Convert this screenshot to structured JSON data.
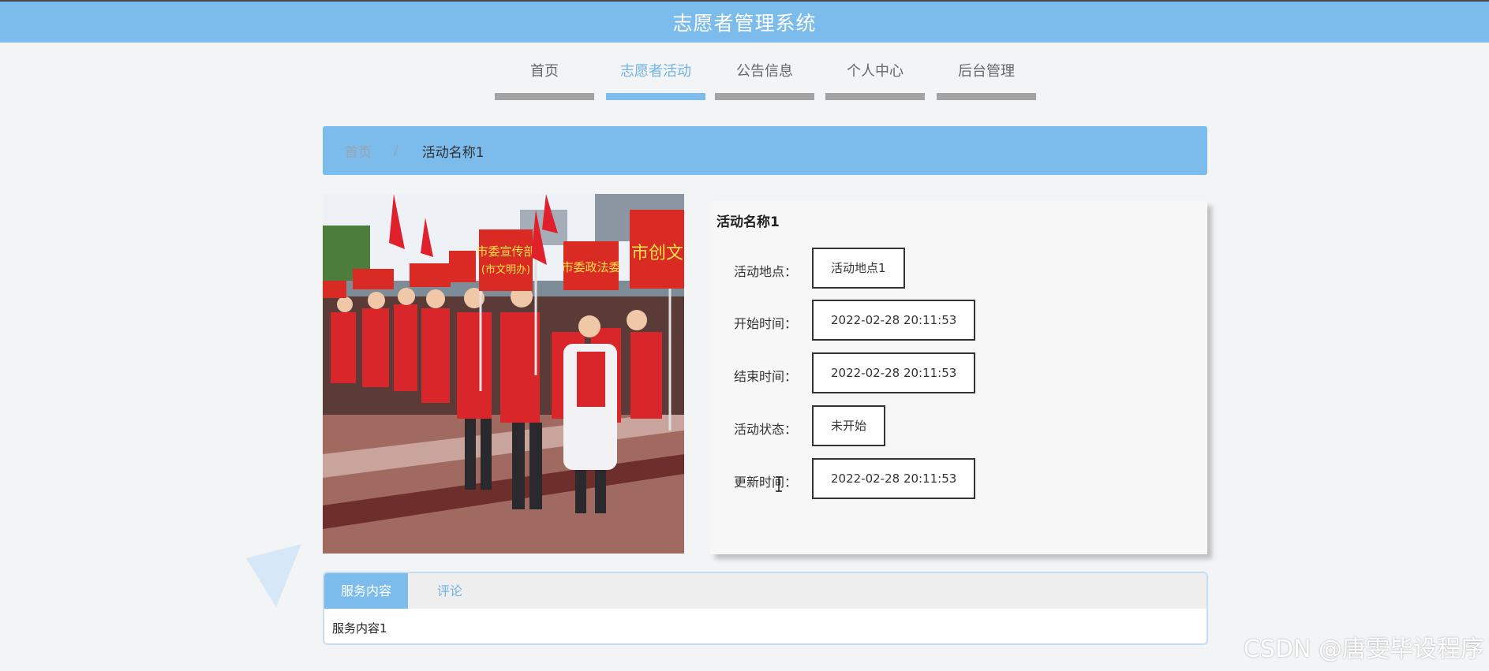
{
  "app": {
    "title": "志愿者管理系统"
  },
  "nav": {
    "items": [
      {
        "label": "首页",
        "active": false
      },
      {
        "label": "志愿者活动",
        "active": true
      },
      {
        "label": "公告信息",
        "active": false
      },
      {
        "label": "个人中心",
        "active": false
      },
      {
        "label": "后台管理",
        "active": false
      }
    ]
  },
  "breadcrumb": {
    "home": "首页",
    "separator": "/",
    "current": "活动名称1"
  },
  "activity": {
    "name": "活动名称1",
    "fields": [
      {
        "label": "活动地点：",
        "value": "活动地点1"
      },
      {
        "label": "开始时间：",
        "value": "2022-02-28 20:11:53"
      },
      {
        "label": "结束时间：",
        "value": "2022-02-28 20:11:53"
      },
      {
        "label": "活动状态：",
        "value": "未开始"
      },
      {
        "label": "更新时间：",
        "value": "2022-02-28 20:11:53"
      }
    ]
  },
  "photo": {
    "signs": [
      "市委宣传部",
      "(市文明办)",
      "市委政法委",
      "市创文"
    ]
  },
  "tabs": {
    "items": [
      {
        "label": "服务内容",
        "active": true
      },
      {
        "label": "评论",
        "active": false
      }
    ],
    "content": "服务内容1"
  },
  "watermark": "CSDN @唐雯毕设程序",
  "colors": {
    "primary": "#7bbcec",
    "nav_bar": "#a3a3a3",
    "background": "#f3f4f5"
  }
}
